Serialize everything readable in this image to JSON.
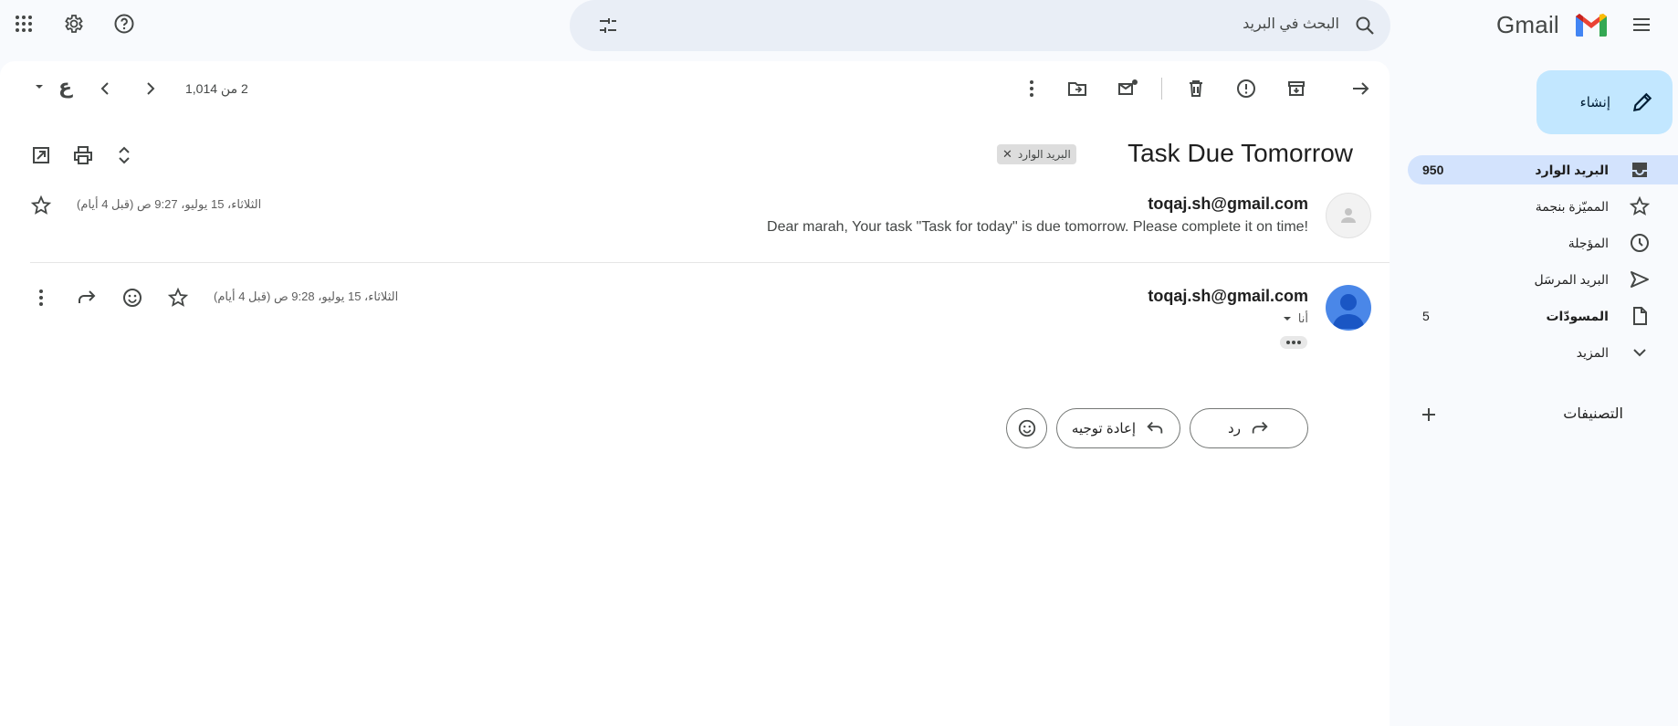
{
  "app": {
    "name": "Gmail"
  },
  "search": {
    "placeholder": "البحث في البريد"
  },
  "toolbar": {
    "pagination": "2 من 1,014",
    "input_tool_label": "ع"
  },
  "thread": {
    "subject": "Task Due Tomorrow",
    "label_chip": "البريد الوارد",
    "messages": [
      {
        "sender": "toqaj.sh@gmail.com",
        "date": "الثلاثاء، 15 يوليو، 9:27 ص (قبل 4 أيام)",
        "snippet": "Dear marah, Your task \"Task for today\" is due tomorrow. Please complete it on time!"
      },
      {
        "sender": "toqaj.sh@gmail.com",
        "date": "الثلاثاء، 15 يوليو، 9:28 ص (قبل 4 أيام)",
        "to": "أنا"
      }
    ],
    "reply_label": "رد",
    "forward_label": "إعادة توجيه"
  },
  "sidebar": {
    "compose_label": "إنشاء",
    "items": [
      {
        "label": "البريد الوارد",
        "count": "950",
        "icon": "inbox-icon"
      },
      {
        "label": "المميّزة بنجمة",
        "count": "",
        "icon": "star-icon"
      },
      {
        "label": "المؤجلة",
        "count": "",
        "icon": "clock-icon"
      },
      {
        "label": "البريد المرسَل",
        "count": "",
        "icon": "send-icon"
      },
      {
        "label": "المسودّات",
        "count": "5",
        "icon": "draft-icon"
      },
      {
        "label": "المزيد",
        "count": "",
        "icon": "chevron-down-icon"
      }
    ],
    "labels_heading": "التصنيفات"
  },
  "colors": {
    "accent": "#c2e7ff",
    "active_nav": "#d3e3fd",
    "background": "#f8fafd",
    "search_bg": "#e9eef6"
  }
}
